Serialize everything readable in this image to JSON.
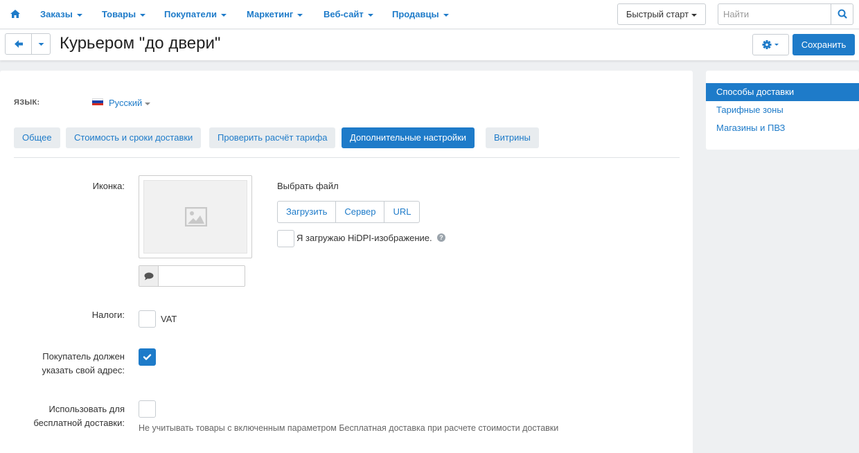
{
  "nav": {
    "items": [
      "Заказы",
      "Товары",
      "Покупатели",
      "Маркетинг",
      "Веб-сайт",
      "Продавцы"
    ],
    "quick_start": "Быстрый старт",
    "search_placeholder": "Найти"
  },
  "header": {
    "title": "Курьером \"до двери\"",
    "save_label": "Сохранить"
  },
  "language": {
    "label": "ЯЗЫК:",
    "value": "Русский"
  },
  "tabs": [
    {
      "label": "Общее",
      "active": false
    },
    {
      "label": "Стоимость и сроки доставки",
      "active": false
    },
    {
      "label": "Проверить расчёт тарифа",
      "active": false
    },
    {
      "label": "Дополнительные настройки",
      "active": true
    },
    {
      "label": "Витрины",
      "active": false
    }
  ],
  "form": {
    "icon_label": "Иконка:",
    "choose_file": "Выбрать файл",
    "file_buttons": [
      "Загрузить",
      "Сервер",
      "URL"
    ],
    "hidpi_label": "Я загружаю HiDPI-изображение.",
    "hidpi_checked": false,
    "alt_value": "",
    "taxes_label": "Налоги:",
    "tax_name": "VAT",
    "tax_checked": false,
    "address_label_1": "Покупатель должен",
    "address_label_2": "указать свой адрес:",
    "address_checked": true,
    "free_label_1": "Использовать для",
    "free_label_2": "бесплатной доставки:",
    "free_checked": false,
    "free_hint": "Не учитывать товары с включенным параметром Бесплатная доставка при расчете стоимости доставки"
  },
  "sidebar": {
    "items": [
      {
        "label": "Способы доставки",
        "active": true
      },
      {
        "label": "Тарифные зоны",
        "active": false
      },
      {
        "label": "Магазины и ПВЗ",
        "active": false
      }
    ]
  },
  "colors": {
    "accent": "#1e7bc9",
    "background": "#eef0f2"
  }
}
